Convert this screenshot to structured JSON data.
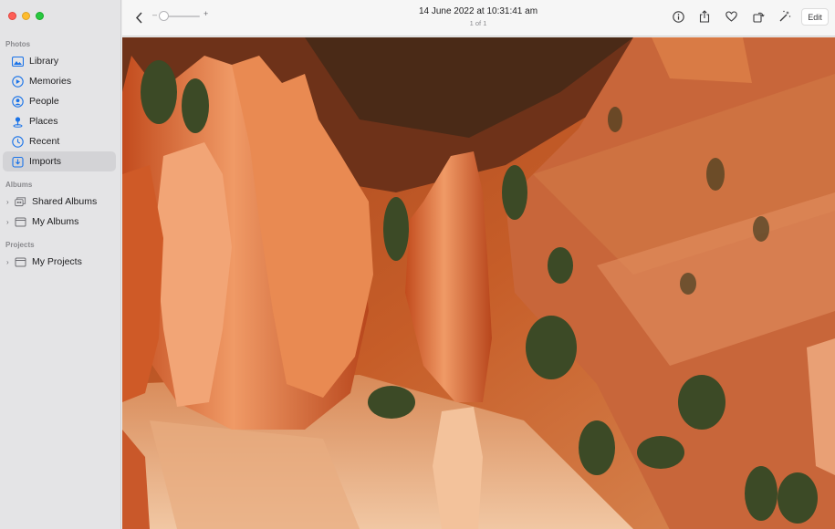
{
  "sidebar": {
    "sections": [
      {
        "heading": "Photos"
      },
      {
        "heading": "Albums"
      },
      {
        "heading": "Projects"
      }
    ],
    "library_items": [
      {
        "label": "Library",
        "icon": "photo-library-icon"
      },
      {
        "label": "Memories",
        "icon": "memories-icon"
      },
      {
        "label": "People",
        "icon": "people-icon"
      },
      {
        "label": "Places",
        "icon": "places-pin-icon"
      },
      {
        "label": "Recent",
        "icon": "recent-clock-icon"
      },
      {
        "label": "Imports",
        "icon": "imports-icon",
        "selected": true
      }
    ],
    "album_items": [
      {
        "label": "Shared Albums",
        "icon": "shared-albums-icon"
      },
      {
        "label": "My Albums",
        "icon": "folder-icon"
      }
    ],
    "project_items": [
      {
        "label": "My Projects",
        "icon": "folder-icon"
      }
    ]
  },
  "toolbar": {
    "zoom_minus": "–",
    "zoom_plus": "+",
    "title": "14 June 2022 at 10:31:41 am",
    "subtitle": "1 of 1",
    "icons": [
      "info-icon",
      "share-icon",
      "favorite-heart-icon",
      "rotate-icon",
      "auto-enhance-wand-icon"
    ],
    "edit_label": "Edit"
  },
  "colors": {
    "accent": "#1a73e8",
    "sidebar_bg": "#e4e4e6",
    "selected_bg": "#d3d3d6"
  }
}
